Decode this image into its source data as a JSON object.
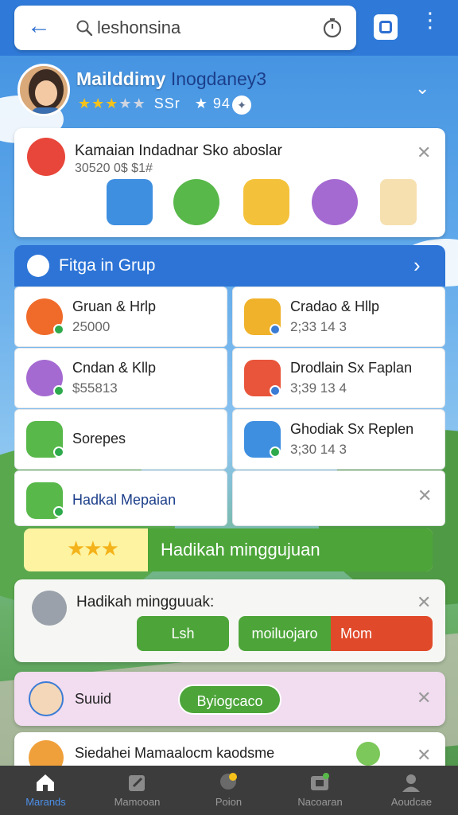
{
  "search": {
    "query": "leshonsina"
  },
  "profile": {
    "name": "Mailddimy",
    "handle": "Inogdaney3",
    "rating": 3,
    "max_rating": 5,
    "score": "SSr",
    "score2": "94"
  },
  "notification": {
    "title": "Kamaian Indadnar Sko aboslar",
    "subtitle": "30520 0$ $1#"
  },
  "group": {
    "title": "Fitga in Grup",
    "cells": [
      {
        "title": "Gruan & Hrlp",
        "sub": "25000"
      },
      {
        "title": "Cradao & Hllp",
        "sub": "2;33 14 3"
      },
      {
        "title": "Cndan & Kllp",
        "sub": "$55813"
      },
      {
        "title": "Drodlain Sx Faplan",
        "sub": "3;39 13 4"
      },
      {
        "title": "Sorepes",
        "sub": ""
      },
      {
        "title": "Ghodiak Sx Replen",
        "sub": "3;30 14 3"
      },
      {
        "title": "Hadkal Mepaian",
        "sub": ""
      }
    ]
  },
  "weekly": {
    "bar_label": "Hadikah minggujuan",
    "card_title": "Hadikah mingguuak:",
    "btn_left": "Lsh",
    "btn_mid": "moiluojaro",
    "btn_right": "Mom"
  },
  "social": {
    "name": "Suuid",
    "pill": "Byiogcaco"
  },
  "last": {
    "title": "Siedahei Mamaalocm kaodsme"
  },
  "nav": [
    {
      "label": "Marands",
      "active": true
    },
    {
      "label": "Mamooan"
    },
    {
      "label": "Poion"
    },
    {
      "label": "Nacoaran"
    },
    {
      "label": "Aoudcae"
    }
  ],
  "colors": {
    "primary": "#2d74d6",
    "green": "#4da53a",
    "red": "#e04a2a",
    "nav_bg": "#3c3c3c"
  }
}
